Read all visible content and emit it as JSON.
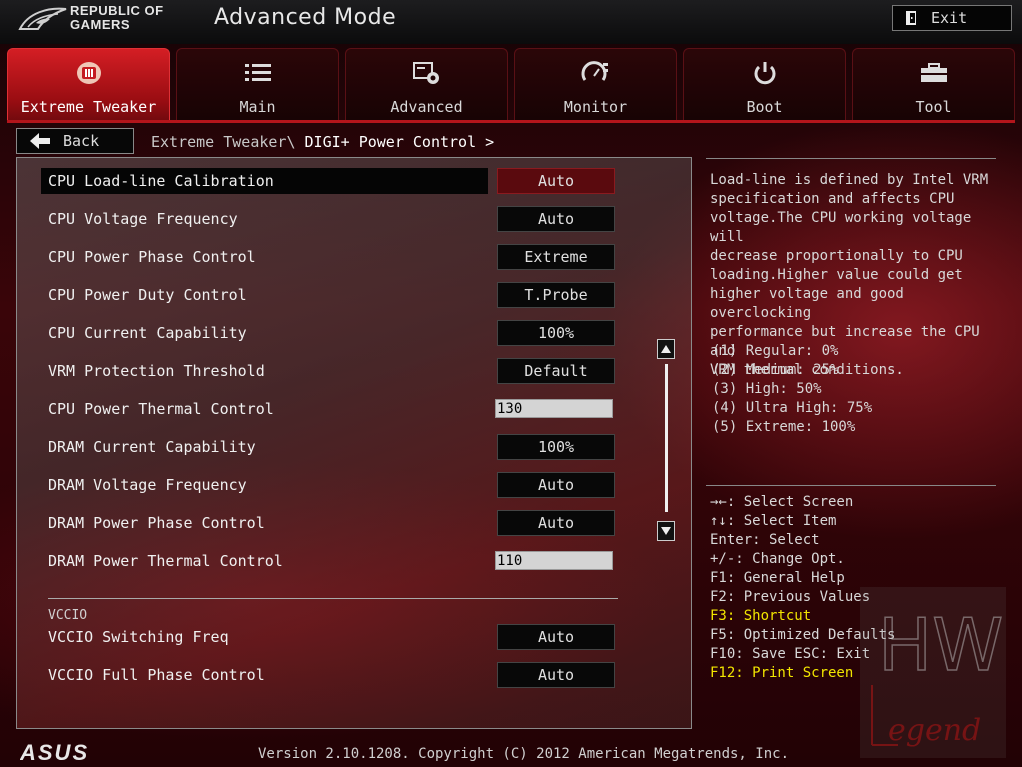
{
  "header": {
    "brand_line1": "REPUBLIC OF",
    "brand_line2": "GAMERS",
    "mode_title": "Advanced Mode",
    "exit_label": "Exit"
  },
  "tabs": [
    {
      "label": "Extreme Tweaker",
      "icon": "extreme-tweaker-icon",
      "active": true
    },
    {
      "label": "Main",
      "icon": "list-icon",
      "active": false
    },
    {
      "label": "Advanced",
      "icon": "advanced-settings-icon",
      "active": false
    },
    {
      "label": "Monitor",
      "icon": "monitor-gauge-icon",
      "active": false
    },
    {
      "label": "Boot",
      "icon": "power-icon",
      "active": false
    },
    {
      "label": "Tool",
      "icon": "toolbox-icon",
      "active": false
    }
  ],
  "nav": {
    "back_label": "Back",
    "breadcrumb_parent": "Extreme Tweaker\\",
    "breadcrumb_current": "DIGI+ Power Control >"
  },
  "settings": [
    {
      "label": "CPU Load-line Calibration",
      "value": "Auto",
      "kind": "option",
      "selected": true
    },
    {
      "label": "CPU Voltage Frequency",
      "value": "Auto",
      "kind": "option"
    },
    {
      "label": "CPU Power Phase Control",
      "value": "Extreme",
      "kind": "option"
    },
    {
      "label": "CPU Power Duty Control",
      "value": "T.Probe",
      "kind": "option"
    },
    {
      "label": "CPU Current Capability",
      "value": "100%",
      "kind": "option"
    },
    {
      "label": "VRM Protection Threshold",
      "value": "Default",
      "kind": "option"
    },
    {
      "label": "CPU Power Thermal Control",
      "value": "130",
      "kind": "number"
    },
    {
      "label": "DRAM Current Capability",
      "value": "100%",
      "kind": "option"
    },
    {
      "label": "DRAM Voltage Frequency",
      "value": "Auto",
      "kind": "option"
    },
    {
      "label": "DRAM Power Phase Control",
      "value": "Auto",
      "kind": "option"
    },
    {
      "label": "DRAM Power Thermal Control",
      "value": "110",
      "kind": "number"
    }
  ],
  "vccio": {
    "section_title": "VCCIO",
    "settings": [
      {
        "label": "VCCIO Switching Freq",
        "value": "Auto",
        "kind": "option"
      },
      {
        "label": "VCCIO Full Phase Control",
        "value": "Auto",
        "kind": "option"
      }
    ]
  },
  "help": {
    "description": "Load-line is defined by Intel VRM\nspecification and affects CPU\nvoltage.The CPU working voltage will\ndecrease proportionally to CPU\nloading.Higher value could get\nhigher voltage and good overclocking\nperformance but increase the CPU and\nVRM thermal conditions.",
    "levels": [
      "(1) Regular: 0%",
      "(2) Medium: 25%",
      "(3) High: 50%",
      "(4) Ultra High: 75%",
      "(5) Extreme: 100%"
    ]
  },
  "keys": [
    {
      "text": "→←: Select Screen",
      "highlight": false
    },
    {
      "text": "↑↓: Select Item",
      "highlight": false
    },
    {
      "text": "Enter: Select",
      "highlight": false
    },
    {
      "text": "+/-: Change Opt.",
      "highlight": false
    },
    {
      "text": "F1: General Help",
      "highlight": false
    },
    {
      "text": "F2: Previous Values",
      "highlight": false
    },
    {
      "text": "F3: Shortcut",
      "highlight": true
    },
    {
      "text": "F5: Optimized Defaults",
      "highlight": false
    },
    {
      "text": "F10: Save  ESC: Exit",
      "highlight": false
    },
    {
      "text": "F12: Print Screen",
      "highlight": true
    }
  ],
  "footer": {
    "version": "Version 2.10.1208. Copyright (C) 2012 American Megatrends, Inc.",
    "brand_logo": "ASUS"
  },
  "watermark": {
    "text_top": "HW",
    "text_bottom": "Legend"
  },
  "colors": {
    "accent_red": "#c81a20",
    "highlight_yellow": "#f2e600",
    "selected_value_bg": "#5a0a0e"
  }
}
